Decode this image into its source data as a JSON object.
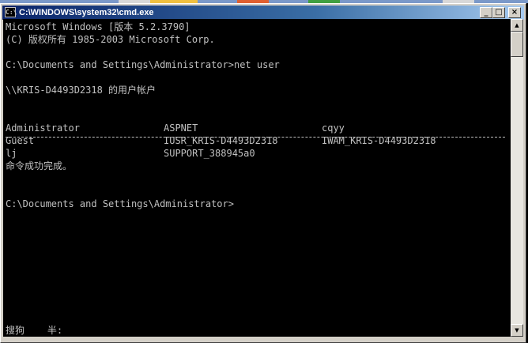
{
  "window": {
    "title": "C:\\WINDOWS\\system32\\cmd.exe",
    "icon_label": "C:\\",
    "buttons": {
      "minimize": "_",
      "maximize": "□",
      "close": "×"
    }
  },
  "console": {
    "line1": "Microsoft Windows [版本 5.2.3790]",
    "line2": "(C) 版权所有 1985-2003 Microsoft Corp.",
    "prompt1": "C:\\Documents and Settings\\Administrator>net user",
    "header": "\\\\KRIS-D4493D2318 的用户帐户",
    "users": [
      [
        "Administrator",
        "ASPNET",
        "cqyy"
      ],
      [
        "Guest",
        "IUSR_KRIS-D4493D2318",
        "IWAM_KRIS-D4493D2318"
      ],
      [
        "lj",
        "SUPPORT_388945a0",
        ""
      ]
    ],
    "success": "命令成功完成。",
    "prompt2": "C:\\Documents and Settings\\Administrator>",
    "ime_status": "搜狗    半:"
  },
  "scrollbar": {
    "up_icon": "▲",
    "down_icon": "▼"
  },
  "colors": {
    "console_bg": "#000000",
    "console_text": "#c0c0c0",
    "titlebar": "#0a246a"
  }
}
